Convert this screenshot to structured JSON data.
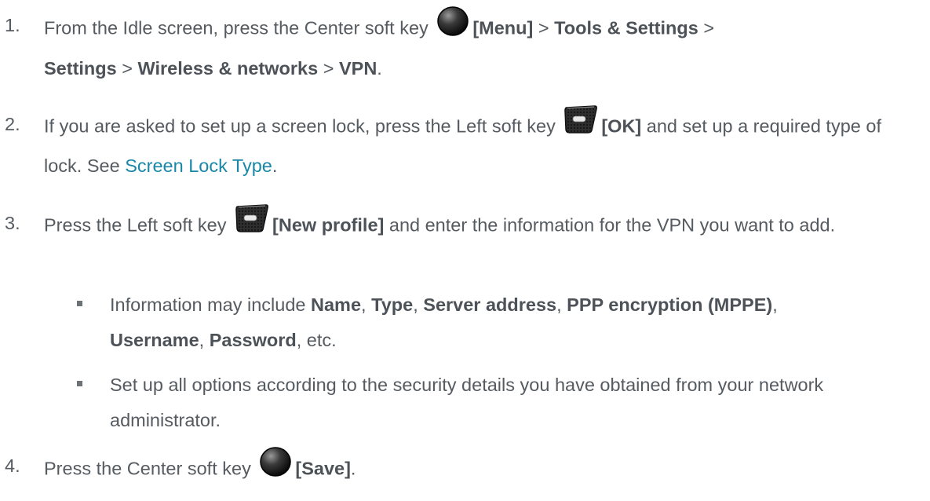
{
  "steps": [
    {
      "num": "1.",
      "pre": "From the Idle screen, press the Center soft key ",
      "key": "center-soft-key-icon",
      "label": "[Menu]",
      "gt1": " > ",
      "p1": "Tools & Settings",
      "gt2": " > ",
      "p2": "Settings",
      "gt3": " > ",
      "p3": "Wireless & networks",
      "gt4": " > ",
      "p4": "VPN",
      "end": "."
    },
    {
      "num": "2.",
      "pre": "If you are asked to set up a screen lock, press the Left soft key ",
      "key": "left-soft-key-icon",
      "label": "[OK]",
      "mid": " and set up a required type of lock. See ",
      "link": "Screen Lock Type",
      "end": "."
    },
    {
      "num": "3.",
      "pre": "Press the Left soft key ",
      "key": "left-soft-key-icon",
      "label": "[New profile]",
      "mid": " and enter the information for the VPN you want to add."
    },
    {
      "num": "4.",
      "pre": "Press the Center soft key ",
      "key": "center-soft-key-icon",
      "label": "[Save]",
      "end": "."
    }
  ],
  "bullets": [
    {
      "pre": "Information may include ",
      "t1": "Name",
      "c1": ", ",
      "t2": "Type",
      "c2": ", ",
      "t3": "Server address",
      "c3": ", ",
      "t4": "PPP encryption (MPPE)",
      "c4": ", ",
      "t5": "Username",
      "c5": ", ",
      "t6": "Password",
      "end": ", etc."
    },
    {
      "text": "Set up all options according to the security details you have obtained from your network administrator."
    }
  ],
  "colors": {
    "text": "#555b60",
    "link": "#1a87a8"
  }
}
